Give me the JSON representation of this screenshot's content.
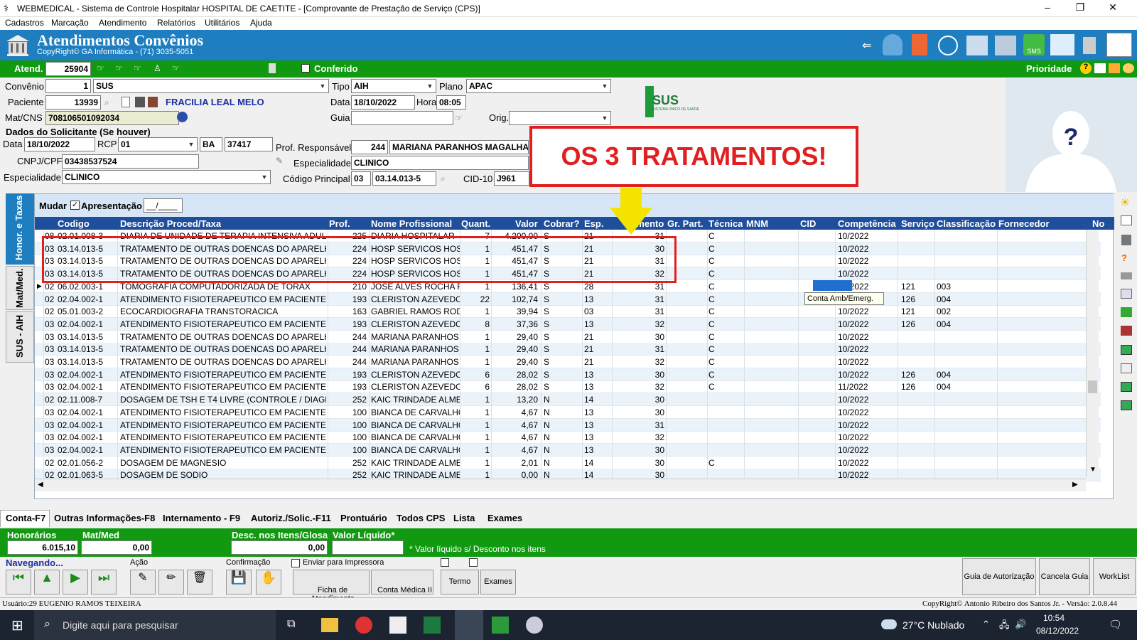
{
  "window": {
    "title": "WEBMEDICAL - Sistema de Controle Hospitalar HOSPITAL DE CAETITE - [Comprovante de Prestação de Serviço  (CPS)]",
    "minimize": "–",
    "maximize": "❐",
    "close": "✕"
  },
  "menu": [
    "Cadastros",
    "Marcação",
    "Atendimento",
    "Relatórios",
    "Utilitários",
    "Ajuda"
  ],
  "banner": {
    "title": "Atendimentos Convênios",
    "subtitle": "CopyRight© GA Informática - (71) 3035-5051"
  },
  "atend": {
    "label": "Atend.",
    "value": "25904",
    "conferido_label": "Conferido",
    "prioridade_label": "Prioridade"
  },
  "form": {
    "convenio_label": "Convênio",
    "convenio_code": "1",
    "convenio_name": "SUS",
    "tipo_label": "Tipo",
    "tipo_value": "AIH",
    "plano_label": "Plano",
    "plano_value": "APAC",
    "paciente_label": "Paciente",
    "paciente_code": "13939",
    "paciente_name": "FRACILIA LEAL MELO",
    "data_label": "Data",
    "data_value": "18/10/2022",
    "hora_label": "Hora",
    "hora_value": "08:05",
    "matcns_label": "Mat/CNS",
    "matcns_value": "708106501092034",
    "guia_label": "Guia",
    "orig_label": "Orig.",
    "solicitante_header": "Dados do Solicitante (Se houver)",
    "sol_data_label": "Data",
    "sol_data_value": "18/10/2022",
    "rcp_label": "RCP",
    "rcp_value": "01",
    "uf_value": "BA",
    "crm_value": "37417",
    "cnpj_label": "CNPJ/CPF",
    "cnpj_value": "03438537524",
    "especialidade_label": "Especialidade",
    "especialidade_value": "CLINICO",
    "prof_resp_label": "Prof. Responsável",
    "prof_resp_code": "244",
    "prof_resp_name": "MARIANA PARANHOS MAGALHAES",
    "esp2_label": "Especialidade",
    "esp2_value": "CLINICO",
    "cod_principal_label": "Código Principal",
    "cod_principal_a": "03",
    "cod_principal_b": "03.14.013-5",
    "cid_label": "CID-10",
    "cid_value": "J961"
  },
  "sus_logo": {
    "text": "SUS",
    "sub": "SISTEMA ÚNICO DE SAÚDE"
  },
  "callout": "OS 3 TRATAMENTOS!",
  "sidetabs": [
    "Honor. e Taxas",
    "Mat/Med.",
    "SUS - AIH"
  ],
  "grid": {
    "mudar_label": "Mudar",
    "apresentacao_label": "Apresentação",
    "apresentacao_value": "__/____",
    "columns": [
      "Codigo",
      "Descrição Proced/Taxa",
      "Prof.",
      "Nome Profissional",
      "Quant.",
      "Valor",
      "Cobrar?",
      "Esp.",
      "ramento",
      "Gr. Part.",
      "Técnica",
      "MNM",
      "CID",
      "Competência",
      "Serviço",
      "Classificação",
      "Fornecedor",
      "No"
    ],
    "rows": [
      [
        "08",
        "02.01.008-3",
        "DIARIA DE UNIDADE DE TERAPIA INTENSIVA ADULTO",
        "225",
        "DIARIA HOSPITALAR",
        "7",
        "4.200,00",
        "S",
        "21",
        "31",
        "C",
        "10/2022",
        "",
        ""
      ],
      [
        "03",
        "03.14.013-5",
        "TRATAMENTO DE OUTRAS DOENCAS DO APARELHO",
        "224",
        "HOSP SERVICOS HOS",
        "1",
        "451,47",
        "S",
        "21",
        "30",
        "C",
        "10/2022",
        "",
        ""
      ],
      [
        "03",
        "03.14.013-5",
        "TRATAMENTO DE OUTRAS DOENCAS DO APARELHO",
        "224",
        "HOSP SERVICOS HOS",
        "1",
        "451,47",
        "S",
        "21",
        "31",
        "C",
        "10/2022",
        "",
        ""
      ],
      [
        "03",
        "03.14.013-5",
        "TRATAMENTO DE OUTRAS DOENCAS DO APARELHO",
        "224",
        "HOSP SERVICOS HOS",
        "1",
        "451,47",
        "S",
        "21",
        "32",
        "C",
        "10/2022",
        "",
        ""
      ],
      [
        "02",
        "06.02.003-1",
        "TOMOGRAFIA COMPUTADORIZADA DE TORAX",
        "210",
        "JOSE ALVES ROCHA F",
        "1",
        "136,41",
        "S",
        "28",
        "31",
        "C",
        "10/2022",
        "121",
        "003"
      ],
      [
        "02",
        "02.04.002-1",
        "ATENDIMENTO FISIOTERAPEUTICO EM PACIENTE C",
        "193",
        "CLERISTON AZEVEDO",
        "22",
        "102,74",
        "S",
        "13",
        "31",
        "C",
        "10/2022",
        "126",
        "004"
      ],
      [
        "02",
        "05.01.003-2",
        "ECOCARDIOGRAFIA TRANSTORACICA",
        "163",
        "GABRIEL RAMOS ROD",
        "1",
        "39,94",
        "S",
        "03",
        "31",
        "C",
        "10/2022",
        "121",
        "002"
      ],
      [
        "03",
        "02.04.002-1",
        "ATENDIMENTO FISIOTERAPEUTICO EM PACIENTE C",
        "193",
        "CLERISTON AZEVEDO",
        "8",
        "37,36",
        "S",
        "13",
        "32",
        "C",
        "10/2022",
        "126",
        "004"
      ],
      [
        "03",
        "03.14.013-5",
        "TRATAMENTO DE OUTRAS DOENCAS DO APARELHO",
        "244",
        "MARIANA PARANHOS I",
        "1",
        "29,40",
        "S",
        "21",
        "30",
        "C",
        "10/2022",
        "",
        ""
      ],
      [
        "03",
        "03.14.013-5",
        "TRATAMENTO DE OUTRAS DOENCAS DO APARELHO",
        "244",
        "MARIANA PARANHOS I",
        "1",
        "29,40",
        "S",
        "21",
        "31",
        "C",
        "10/2022",
        "",
        ""
      ],
      [
        "03",
        "03.14.013-5",
        "TRATAMENTO DE OUTRAS DOENCAS DO APARELHO",
        "244",
        "MARIANA PARANHOS I",
        "1",
        "29,40",
        "S",
        "21",
        "32",
        "C",
        "10/2022",
        "",
        ""
      ],
      [
        "03",
        "02.04.002-1",
        "ATENDIMENTO FISIOTERAPEUTICO EM PACIENTE C",
        "193",
        "CLERISTON AZEVEDO",
        "6",
        "28,02",
        "S",
        "13",
        "30",
        "C",
        "10/2022",
        "126",
        "004"
      ],
      [
        "03",
        "02.04.002-1",
        "ATENDIMENTO FISIOTERAPEUTICO EM PACIENTE C",
        "193",
        "CLERISTON AZEVEDO",
        "6",
        "28,02",
        "S",
        "13",
        "32",
        "C",
        "11/2022",
        "126",
        "004"
      ],
      [
        "02",
        "02.11.008-7",
        "DOSAGEM DE TSH E T4 LIVRE (CONTROLE / DIAGNO",
        "252",
        "KAIC TRINDADE ALME",
        "1",
        "13,20",
        "N",
        "14",
        "30",
        "",
        "10/2022",
        "",
        ""
      ],
      [
        "03",
        "02.04.002-1",
        "ATENDIMENTO FISIOTERAPEUTICO EM PACIENTE C",
        "100",
        "BIANCA DE CARVALHO",
        "1",
        "4,67",
        "N",
        "13",
        "30",
        "",
        "10/2022",
        "",
        ""
      ],
      [
        "03",
        "02.04.002-1",
        "ATENDIMENTO FISIOTERAPEUTICO EM PACIENTE C",
        "100",
        "BIANCA DE CARVALHO",
        "1",
        "4,67",
        "N",
        "13",
        "31",
        "",
        "10/2022",
        "",
        ""
      ],
      [
        "03",
        "02.04.002-1",
        "ATENDIMENTO FISIOTERAPEUTICO EM PACIENTE C",
        "100",
        "BIANCA DE CARVALHO",
        "1",
        "4,67",
        "N",
        "13",
        "32",
        "",
        "10/2022",
        "",
        ""
      ],
      [
        "03",
        "02.04.002-1",
        "ATENDIMENTO FISIOTERAPEUTICO EM PACIENTE C",
        "100",
        "BIANCA DE CARVALHO",
        "1",
        "4,67",
        "N",
        "13",
        "30",
        "",
        "10/2022",
        "",
        ""
      ],
      [
        "02",
        "02.01.056-2",
        "DOSAGEM DE MAGNESIO",
        "252",
        "KAIC TRINDADE ALME",
        "1",
        "2,01",
        "N",
        "14",
        "30",
        "C",
        "10/2022",
        "",
        ""
      ],
      [
        "02",
        "02.01.063-5",
        "DOSAGEM DE SODIO",
        "252",
        "KAIC TRINDADE ALME",
        "1",
        "0,00",
        "N",
        "14",
        "30",
        "",
        "10/2022",
        "",
        ""
      ]
    ],
    "tooltip": "Conta Amb/Emerg."
  },
  "bottom_tabs": [
    "Conta-F7",
    "Outras Informações-F8",
    "Internamento - F9",
    "Autoriz./Solic.-F11",
    "Prontuário",
    "Todos CPS",
    "Lista",
    "Exames"
  ],
  "totals": {
    "honorarios_label": "Honorários",
    "honorarios_value": "6.015,10",
    "matmed_label": "Mat/Med",
    "matmed_value": "0,00",
    "desc_label": "Desc. nos Itens/Glosa",
    "desc_value": "0,00",
    "liquido_label": "Valor Líquido*",
    "note": "* Valor líquido s/ Desconto nos itens"
  },
  "nav": {
    "navegando": "Navegando...",
    "acao": "Ação",
    "confirmacao": "Confirmação",
    "enviar": "Enviar para Impressora",
    "ficha": "Ficha de Atendimento",
    "conta_medica": "Conta Médica II",
    "termo": "Termo",
    "exames": "Exames",
    "guia_autorizacao": "Guia de Autorização",
    "cancela_guia": "Cancela Guia",
    "worklist": "WorkList"
  },
  "status": {
    "user": "Usuário:29 EUGENIO RAMOS TEIXEIRA",
    "copyright": "CopyRight© Antonio Ribeiro dos Santos Jr. - Versão: 2.0.8.44"
  },
  "taskbar": {
    "search": "Digite aqui para pesquisar",
    "weather": "27°C  Nublado",
    "time": "10:54",
    "date": "08/12/2022"
  },
  "colors": {
    "banner_blue": "#1e7ec0",
    "green": "#119a11",
    "grid_header": "#1f4f9c",
    "highlight_red": "#e02020",
    "arrow_yellow": "#f5e300"
  }
}
